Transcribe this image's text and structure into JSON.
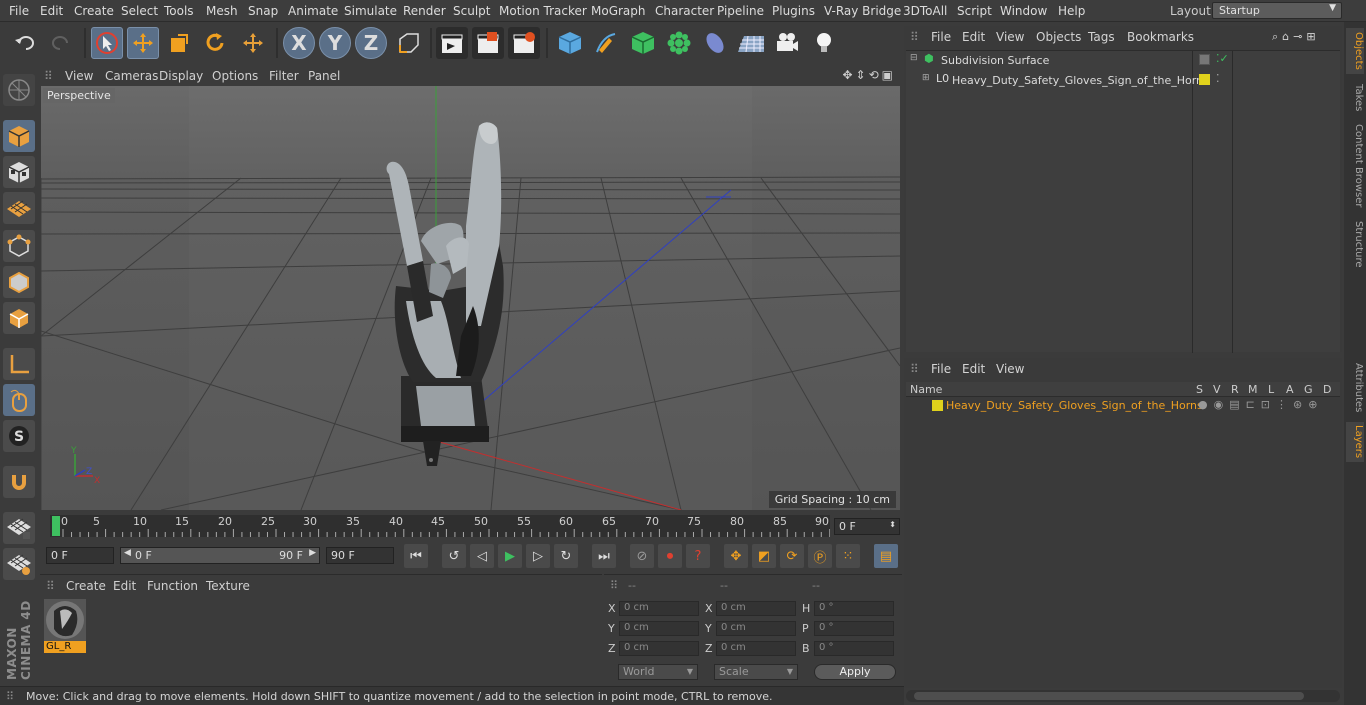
{
  "menubar": {
    "items": [
      "File",
      "Edit",
      "Create",
      "Select",
      "Tools",
      "Mesh",
      "Snap",
      "Animate",
      "Simulate",
      "Render",
      "Sculpt",
      "Motion Tracker",
      "MoGraph",
      "Character",
      "Pipeline",
      "Plugins",
      "V-Ray Bridge",
      "3DToAll",
      "Script",
      "Window",
      "Help"
    ],
    "layout_label": "Layout:",
    "layout_value": "Startup"
  },
  "toolbar": {
    "undo_icon": "undo-icon",
    "axis_x": "X",
    "axis_y": "Y",
    "axis_z": "Z"
  },
  "viewport": {
    "menu": [
      "View",
      "Cameras",
      "Display",
      "Options",
      "Filter",
      "Panel"
    ],
    "label": "Perspective",
    "grid_spacing": "Grid Spacing : 10 cm",
    "axis_x": "X",
    "axis_y": "Y",
    "axis_z": "Z"
  },
  "timeline": {
    "ticks": [
      "0",
      "5",
      "10",
      "15",
      "20",
      "25",
      "30",
      "35",
      "40",
      "45",
      "50",
      "55",
      "60",
      "65",
      "70",
      "75",
      "80",
      "85",
      "90"
    ],
    "current_frame": "0 F"
  },
  "transport": {
    "start_field": "0 F",
    "range_start": "0 F",
    "range_end": "90 F",
    "end_field": "90 F"
  },
  "material": {
    "menu": [
      "Create",
      "Edit",
      "Function",
      "Texture"
    ],
    "name": "GL_R"
  },
  "coordinates": {
    "header": [
      "--",
      "--",
      "--"
    ],
    "rows": [
      {
        "a": "X",
        "av": "0 cm",
        "b": "X",
        "bv": "0 cm",
        "c": "H",
        "cv": "0 °"
      },
      {
        "a": "Y",
        "av": "0 cm",
        "b": "Y",
        "bv": "0 cm",
        "c": "P",
        "cv": "0 °"
      },
      {
        "a": "Z",
        "av": "0 cm",
        "b": "Z",
        "bv": "0 cm",
        "c": "B",
        "cv": "0 °"
      }
    ],
    "mode": "World",
    "scale": "Scale",
    "apply": "Apply"
  },
  "objects": {
    "menu": [
      "File",
      "Edit",
      "View",
      "Objects",
      "Tags",
      "Bookmarks"
    ],
    "items": [
      {
        "name": "Subdivision Surface"
      },
      {
        "name": "Heavy_Duty_Safety_Gloves_Sign_of_the_Horns"
      }
    ]
  },
  "layers": {
    "menu": [
      "File",
      "Edit",
      "View"
    ],
    "columns": [
      "Name",
      "S",
      "V",
      "R",
      "M",
      "L",
      "A",
      "G",
      "D"
    ],
    "row_name": "Heavy_Duty_Safety_Gloves_Sign_of_the_Horns"
  },
  "sidetabs": [
    "Objects",
    "Takes",
    "Content Browser",
    "Structure",
    "Attributes",
    "Layers"
  ],
  "status": "Move: Click and drag to move elements. Hold down SHIFT to quantize movement / add to the selection in point mode, CTRL to remove.",
  "brand": "MAXON CINEMA 4D",
  "colors": {
    "accent": "#f0a020",
    "selected": "#5a6f88",
    "layer": "#e0d21c"
  }
}
